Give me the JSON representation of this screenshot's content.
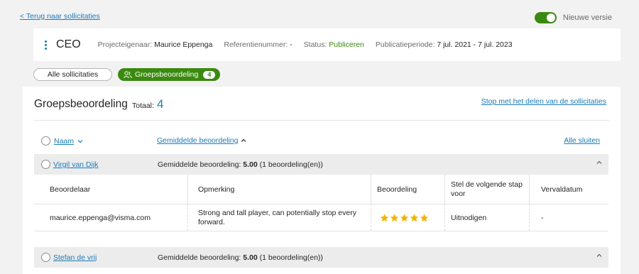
{
  "back_link": "< Terug naar sollicitaties",
  "toggle": {
    "label": "Nieuwe versie",
    "on": true,
    "color": "#3a8a0f"
  },
  "header": {
    "title": "CEO",
    "owner_label": "Projecteigenaar:",
    "owner_value": "Maurice Eppenga",
    "ref_label": "Referentienummer:",
    "ref_value": "-",
    "status_label": "Status:",
    "status_value": "Publiceren",
    "period_label": "Publicatieperiode:",
    "period_value": "7 jul. 2021 - 7 jul. 2023"
  },
  "tabs": {
    "all_label": "Alle sollicitaties",
    "group_label": "Groepsbeoordeling",
    "group_count": "4"
  },
  "group_review": {
    "title": "Groepsbeoordeling",
    "total_label": "Totaal:",
    "total_value": "4",
    "stop_sharing": "Stop met het delen van de sollicitaties",
    "sort_name": "Naam",
    "sort_avg": "Gemiddelde beoordeling",
    "close_all": "Alle sluiten",
    "candidates": [
      {
        "name": "Virgil van Dijk",
        "avg_prefix": "Gemiddelde beoordeling:",
        "avg_value": "5.00",
        "avg_suffix": "(1 beoordeling(en))"
      },
      {
        "name": "Stefan de vrij",
        "avg_prefix": "Gemiddelde beoordeling:",
        "avg_value": "5.00",
        "avg_suffix": "(1 beoordeling(en))"
      }
    ],
    "table": {
      "headers": {
        "reviewer": "Beoordelaar",
        "comment": "Opmerking",
        "rating": "Beoordeling",
        "next_step": "Stel de volgende stap voor",
        "expiry": "Vervaldatum"
      },
      "row": {
        "reviewer": "maurice.eppenga@visma.com",
        "comment": "Strong and tall player, can potentially stop every forward.",
        "rating": 5,
        "next_step": "Uitnodigen",
        "expiry": "-"
      }
    }
  },
  "colors": {
    "link": "#1a7bb9",
    "accent_green": "#3a8a0f",
    "star": "#f0b400"
  }
}
